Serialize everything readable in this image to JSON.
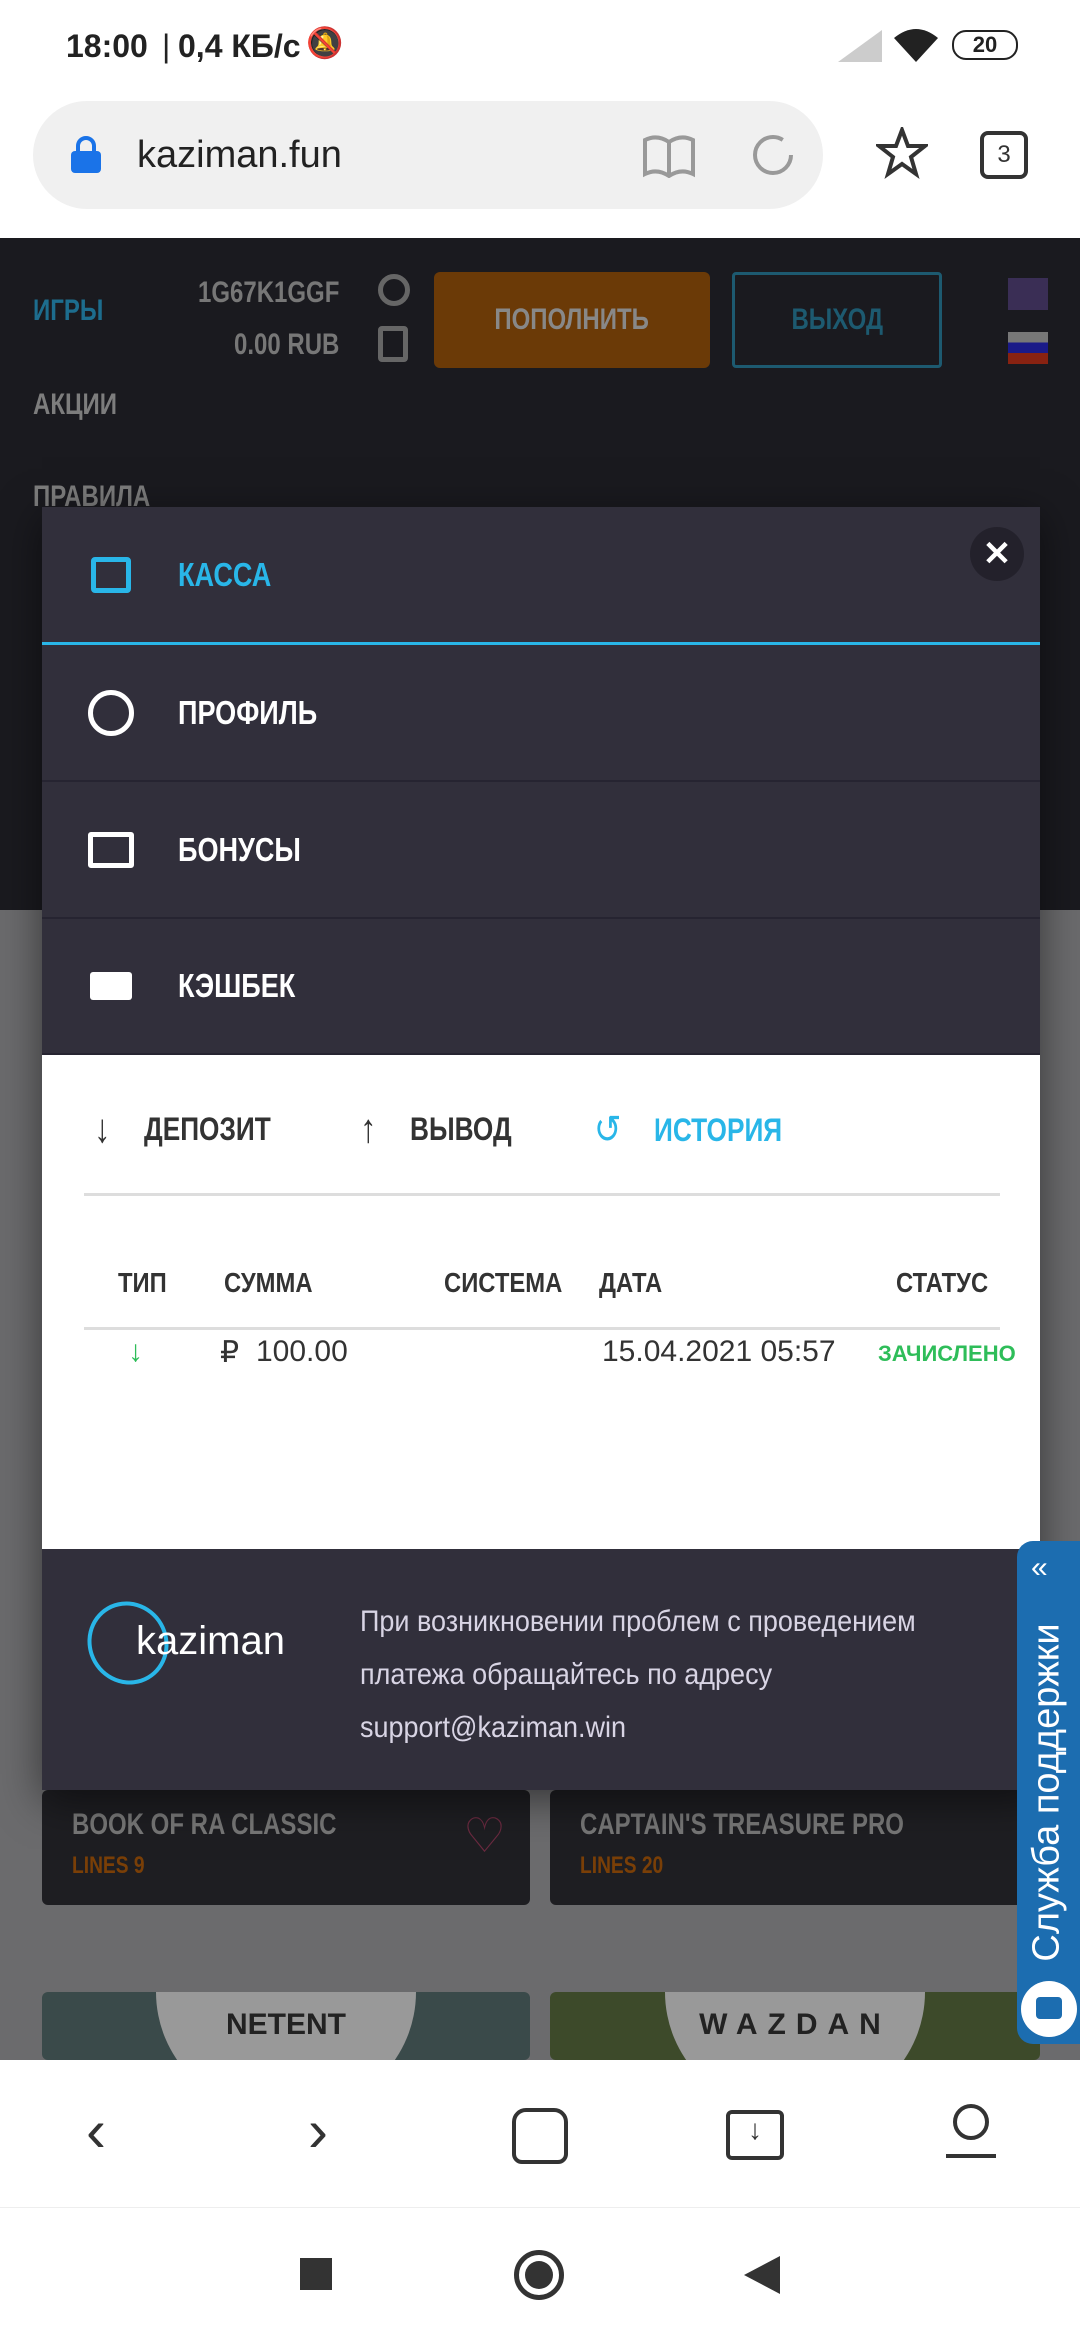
{
  "status_bar": {
    "time": "18:00",
    "speed": "0,4 КБ/с",
    "battery": "20"
  },
  "browser": {
    "url": "kaziman.fun",
    "tabs_count": "3"
  },
  "site": {
    "nav": [
      "ИГРЫ",
      "АКЦИИ",
      "ПРАВИЛА"
    ],
    "user_id": "1G67K1GGF",
    "balance": "0.00 RUB",
    "deposit_button": "ПОПОЛНИТЬ",
    "logout_button": "ВЫХОД"
  },
  "games": [
    {
      "title": "BOOK OF RA CLASSIC",
      "lines": "LINES 9"
    },
    {
      "title": "CAPTAIN'S TREASURE PRO",
      "lines": "LINES 20"
    }
  ],
  "providers": [
    "NETENT",
    "WAZDAN"
  ],
  "modal": {
    "menu": [
      {
        "label": "КАССА",
        "icon": "wallet-icon"
      },
      {
        "label": "ПРОФИЛЬ",
        "icon": "face-icon"
      },
      {
        "label": "БОНУСЫ",
        "icon": "gift-icon"
      },
      {
        "label": "КЭШБЕК",
        "icon": "cash-icon"
      }
    ],
    "tabs": [
      {
        "label": "ДЕПОЗИТ"
      },
      {
        "label": "ВЫВОД"
      },
      {
        "label": "ИСТОРИЯ",
        "active": true
      }
    ],
    "table": {
      "headers": [
        "ТИП",
        "СУММА",
        "СИСТЕМА",
        "ДАТА",
        "СТАТУС"
      ],
      "rows": [
        {
          "type": "deposit",
          "currency": "₽",
          "amount": "100.00",
          "system": "",
          "date": "15.04.2021 05:57",
          "status": "ЗАЧИСЛЕНО"
        }
      ]
    },
    "footer": {
      "logo": "kaziman",
      "text": "При возникновении проблем с проведением платежа обращайтесь по адресу support@kaziman.win"
    }
  },
  "support_tab": "Служба поддержки",
  "colors": {
    "accent": "#29b6e8",
    "orange": "#7a3f07",
    "status_green": "#2ebd59",
    "modal_bg": "#312f3b"
  }
}
